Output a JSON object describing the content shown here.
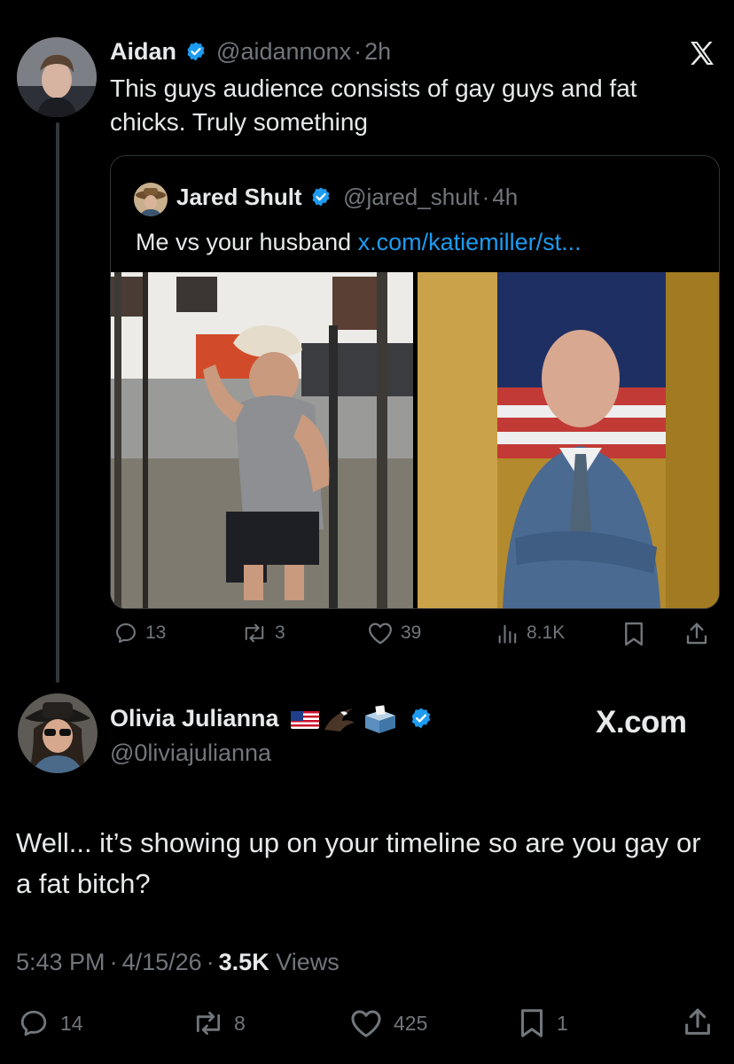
{
  "reply": {
    "author_name": "Aidan",
    "handle": "@aidannonx",
    "sep": "·",
    "time": "2h",
    "text": "This guys audience consists of gay guys and fat chicks. Truly something"
  },
  "quote": {
    "author_name": "Jared Shult",
    "handle": "@jared_shult",
    "sep": "·",
    "time": "4h",
    "text_prefix": "Me vs your husband ",
    "link": "x.com/katiemiller/st..."
  },
  "reply_actions": {
    "replies": "13",
    "reposts": "3",
    "likes": "39",
    "views": "8.1K"
  },
  "main": {
    "author_name": "Olivia Julianna",
    "emojis": "🇺🇸🦅🗳️",
    "handle": "@0liviajulianna",
    "watermark": "X.com",
    "text": "Well... it’s showing up on your timeline so are you gay or a fat bitch?",
    "time": "5:43 PM",
    "date": "4/15/26",
    "sep": "·",
    "views_count": "3.5K",
    "views_label": "Views"
  },
  "main_actions": {
    "replies": "14",
    "reposts": "8",
    "likes": "425",
    "bookmarks": "1"
  },
  "colors": {
    "verified": "#1d9bf0",
    "link": "#1d9bf0",
    "muted": "#71767b",
    "text": "#e7e9ea"
  }
}
